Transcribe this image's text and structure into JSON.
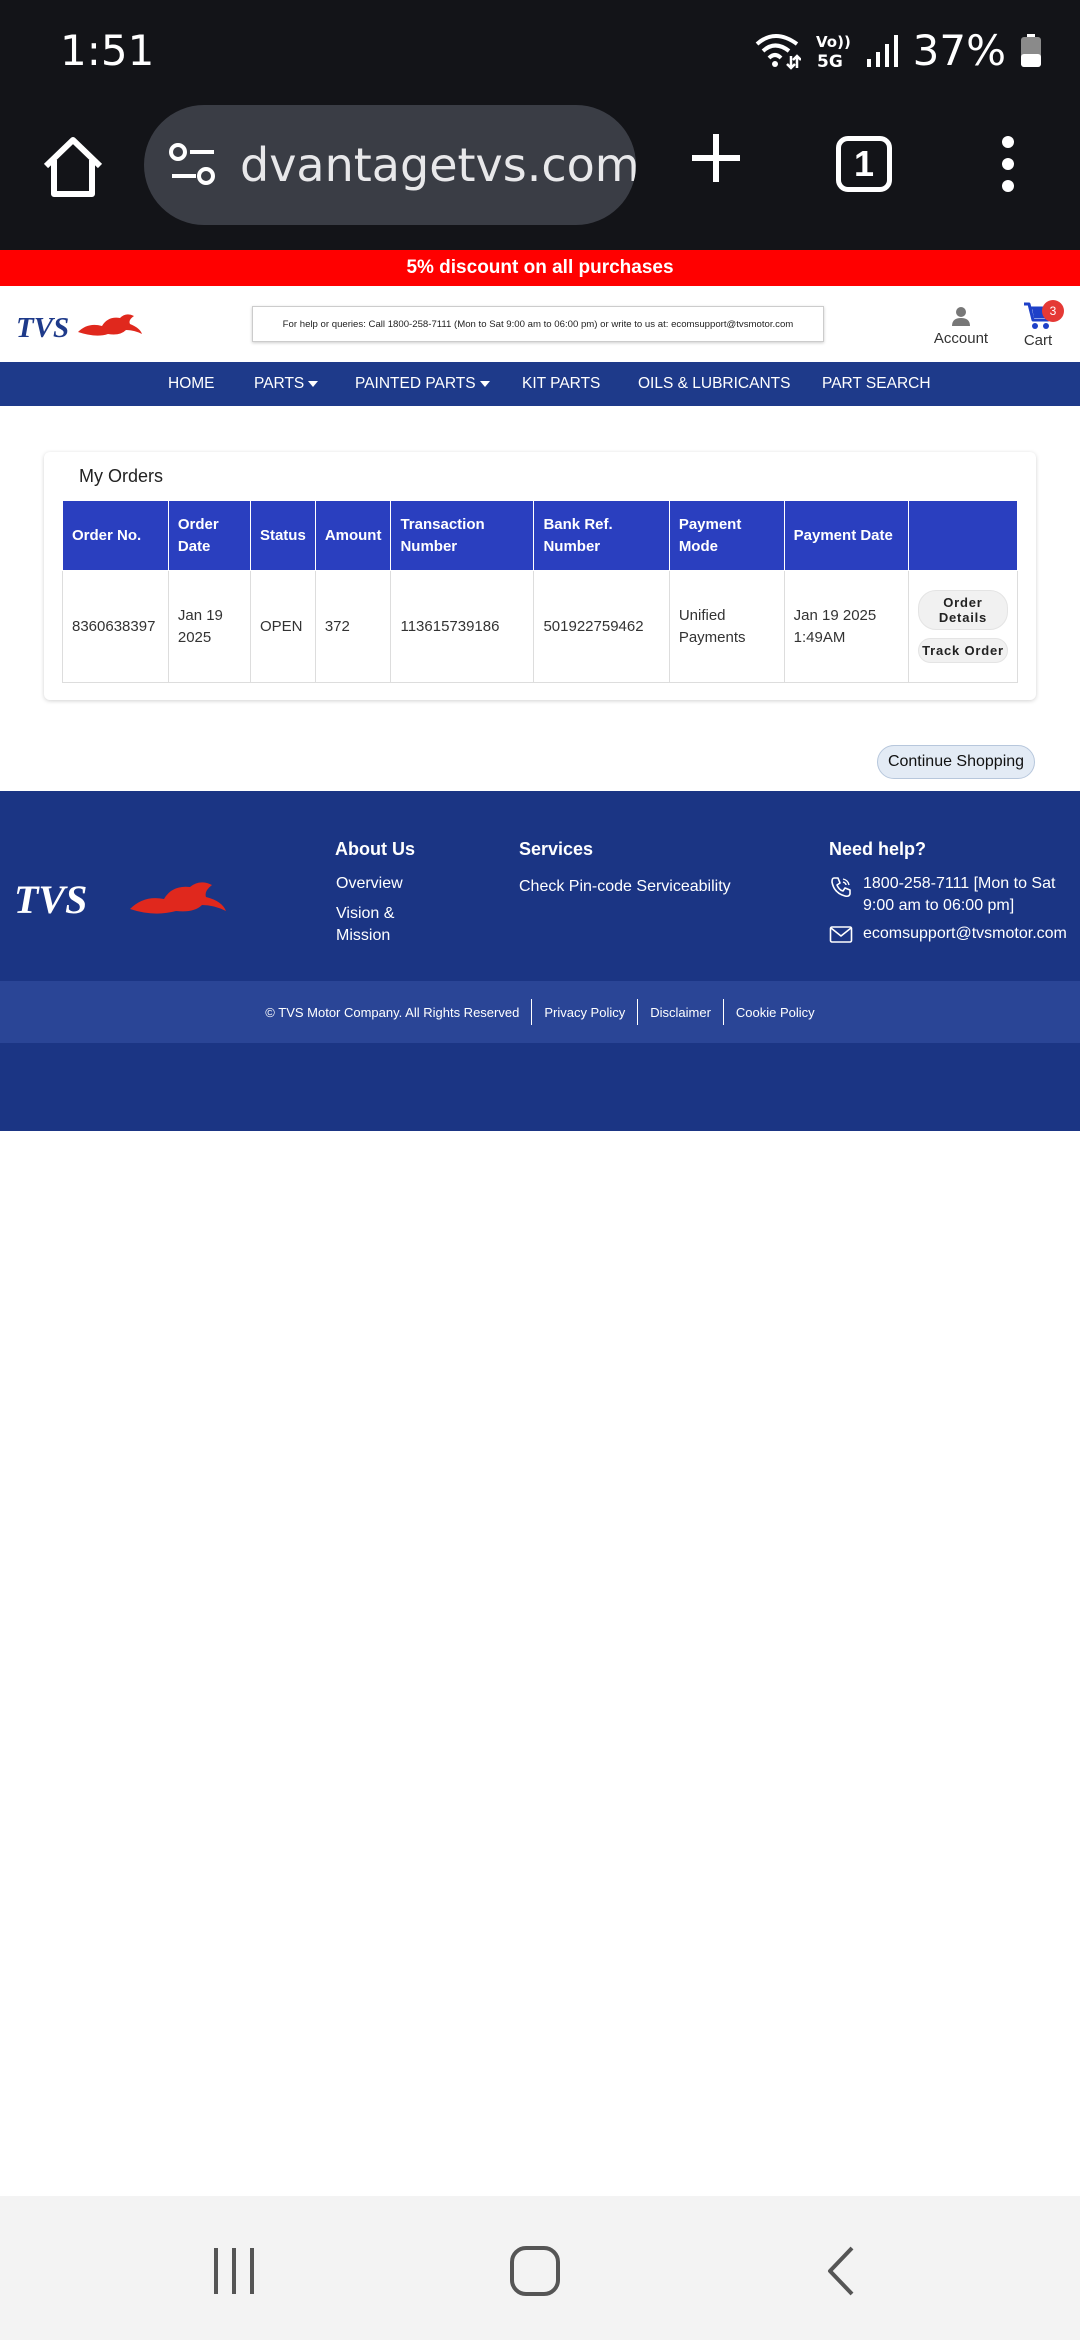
{
  "status_bar": {
    "time": "1:51",
    "network": "Vo)) 5G",
    "battery": "37%"
  },
  "browser": {
    "url": "dvantagetvs.com",
    "tab_count": "1"
  },
  "promo_banner": "5% discount on all purchases",
  "header": {
    "logo_text": "TVS",
    "help_text": "For help or queries: Call 1800-258-7111 (Mon to Sat 9:00 am to 06:00 pm) or write to us at: ecomsupport@tvsmotor.com",
    "account_label": "Account",
    "cart_label": "Cart",
    "cart_count": "3"
  },
  "nav": {
    "items": [
      "HOME",
      "PARTS",
      "PAINTED PARTS",
      "KIT PARTS",
      "OILS & LUBRICANTS",
      "PART SEARCH"
    ]
  },
  "orders": {
    "title": "My Orders",
    "columns": [
      "Order No.",
      "Order Date",
      "Status",
      "Amount",
      "Transaction Number",
      "Bank Ref. Number",
      "Payment Mode",
      "Payment Date",
      ""
    ],
    "rows": [
      {
        "order_no": "8360638397",
        "order_date": "Jan 19 2025",
        "status": "OPEN",
        "amount": "372",
        "transaction_number": "113615739186",
        "bank_ref": "501922759462",
        "payment_mode": "Unified Payments",
        "payment_date": "Jan 19 2025 1:49AM",
        "details_label": "Order Details",
        "track_label": "Track Order"
      }
    ],
    "continue_label": "Continue Shopping"
  },
  "footer": {
    "about_title": "About Us",
    "about_links": [
      "Overview",
      "Vision & Mission"
    ],
    "services_title": "Services",
    "services_links": [
      "Check Pin-code Serviceability"
    ],
    "help_title": "Need help?",
    "help_phone": "1800-258-7111 [Mon to Sat 9:00 am to 06:00 pm]",
    "help_email": "ecomsupport@tvsmotor.com",
    "copyright": "© TVS Motor Company. All Rights Reserved",
    "bottom_links": [
      "Privacy Policy",
      "Disclaimer",
      "Cookie Policy"
    ]
  },
  "colors": {
    "promo_red": "#ff0000",
    "brand_blue": "#1e3a8a",
    "table_header_blue": "#2a3fbf",
    "logo_red": "#e0281d"
  }
}
